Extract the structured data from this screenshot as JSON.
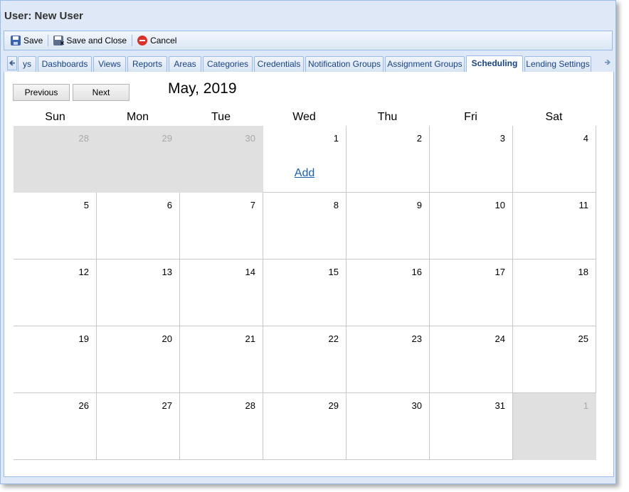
{
  "window": {
    "title": "User: New User"
  },
  "toolbar": {
    "save_label": "Save",
    "save_close_label": "Save and Close",
    "cancel_label": "Cancel"
  },
  "tabs": [
    {
      "label": "ys",
      "active": false
    },
    {
      "label": "Dashboards",
      "active": false
    },
    {
      "label": "Views",
      "active": false
    },
    {
      "label": "Reports",
      "active": false
    },
    {
      "label": "Areas",
      "active": false
    },
    {
      "label": "Categories",
      "active": false
    },
    {
      "label": "Credentials",
      "active": false
    },
    {
      "label": "Notification Groups",
      "active": false
    },
    {
      "label": "Assignment Groups",
      "active": false
    },
    {
      "label": "Scheduling",
      "active": true
    },
    {
      "label": "Lending Settings",
      "active": false
    }
  ],
  "calendar": {
    "previous_label": "Previous",
    "next_label": "Next",
    "month_title": "May, 2019",
    "day_names": [
      "Sun",
      "Mon",
      "Tue",
      "Wed",
      "Thu",
      "Fri",
      "Sat"
    ],
    "add_label": "Add",
    "weeks": [
      [
        {
          "day": "28",
          "other": true
        },
        {
          "day": "29",
          "other": true
        },
        {
          "day": "30",
          "other": true
        },
        {
          "day": "1",
          "other": false,
          "add": true
        },
        {
          "day": "2",
          "other": false
        },
        {
          "day": "3",
          "other": false
        },
        {
          "day": "4",
          "other": false
        }
      ],
      [
        {
          "day": "5",
          "other": false
        },
        {
          "day": "6",
          "other": false
        },
        {
          "day": "7",
          "other": false
        },
        {
          "day": "8",
          "other": false
        },
        {
          "day": "9",
          "other": false
        },
        {
          "day": "10",
          "other": false
        },
        {
          "day": "11",
          "other": false
        }
      ],
      [
        {
          "day": "12",
          "other": false
        },
        {
          "day": "13",
          "other": false
        },
        {
          "day": "14",
          "other": false
        },
        {
          "day": "15",
          "other": false
        },
        {
          "day": "16",
          "other": false
        },
        {
          "day": "17",
          "other": false
        },
        {
          "day": "18",
          "other": false
        }
      ],
      [
        {
          "day": "19",
          "other": false
        },
        {
          "day": "20",
          "other": false
        },
        {
          "day": "21",
          "other": false
        },
        {
          "day": "22",
          "other": false
        },
        {
          "day": "23",
          "other": false
        },
        {
          "day": "24",
          "other": false
        },
        {
          "day": "25",
          "other": false
        }
      ],
      [
        {
          "day": "26",
          "other": false
        },
        {
          "day": "27",
          "other": false
        },
        {
          "day": "28",
          "other": false
        },
        {
          "day": "29",
          "other": false
        },
        {
          "day": "30",
          "other": false
        },
        {
          "day": "31",
          "other": false
        },
        {
          "day": "1",
          "other": true
        }
      ]
    ]
  },
  "colors": {
    "chrome_bg": "#dfe8f6",
    "chrome_border": "#99bbe8",
    "tab_text": "#15428b",
    "other_month_bg": "#e0e0e0",
    "link": "#1a5fb4"
  },
  "icons": {
    "save": "save-icon",
    "save_close": "save-close-icon",
    "cancel": "cancel-icon",
    "scroll_left": "arrow-left-icon",
    "scroll_right": "arrow-right-icon"
  }
}
